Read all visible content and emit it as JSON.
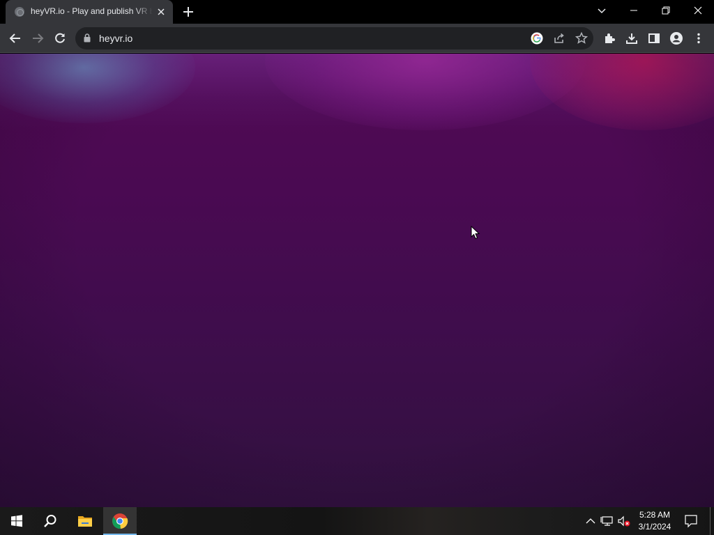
{
  "browser": {
    "tab": {
      "title": "heyVR.io - Play and publish VR browser games",
      "favicon": "globe-icon"
    },
    "address_bar": {
      "url": "heyvr.io"
    },
    "toolbar_icons": [
      "back-icon",
      "forward-icon",
      "reload-icon",
      "lock-icon",
      "google-icon",
      "share-icon",
      "star-icon",
      "extensions-icon",
      "download-icon",
      "side-panel-icon",
      "profile-icon",
      "menu-icon"
    ]
  },
  "page": {
    "colors": {
      "base": "#4a0a52",
      "glow_left": "#6e96c8",
      "glow_center": "#962896",
      "glow_right": "#b9195f"
    }
  },
  "taskbar": {
    "pinned": [
      "windows-start-icon",
      "search-icon",
      "file-explorer-icon",
      "chrome-icon"
    ],
    "clock": {
      "time": "5:28 AM",
      "date": "3/1/2024"
    },
    "tray": [
      "chevron-up-icon",
      "network-icon",
      "volume-muted-icon"
    ]
  },
  "colors": {
    "chrome_dark": "#35363a",
    "omnibox": "#202124",
    "text": "#e8eaed",
    "taskbar_accent": "#76b9ed"
  }
}
